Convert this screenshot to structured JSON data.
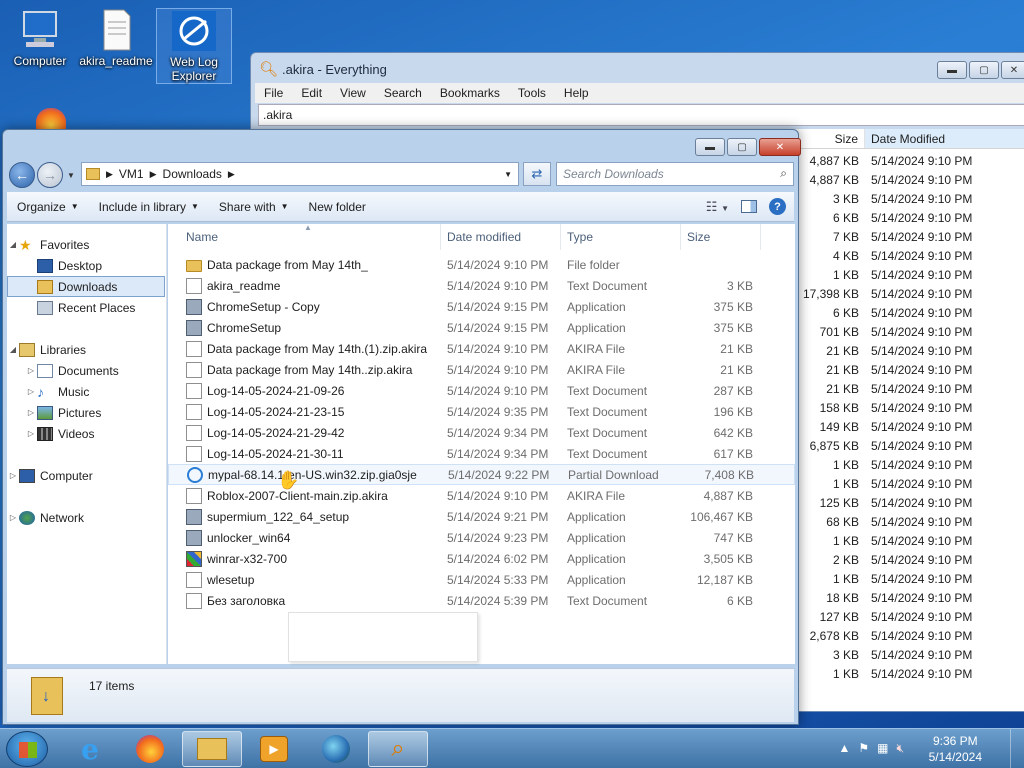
{
  "desktop": {
    "icons": [
      {
        "label": "Computer"
      },
      {
        "label": "akira_readme"
      },
      {
        "label": "Web Log Explorer"
      }
    ]
  },
  "everything": {
    "title": ".akira - Everything",
    "menu": [
      "File",
      "Edit",
      "View",
      "Search",
      "Bookmarks",
      "Tools",
      "Help"
    ],
    "search_value": ".akira",
    "col_size": "Size",
    "col_date": "Date Modified",
    "rows": [
      {
        "size": "4,887 KB",
        "date": "5/14/2024 9:10 PM"
      },
      {
        "size": "4,887 KB",
        "date": "5/14/2024 9:10 PM"
      },
      {
        "size": "3 KB",
        "date": "5/14/2024 9:10 PM"
      },
      {
        "size": "6 KB",
        "date": "5/14/2024 9:10 PM"
      },
      {
        "size": "7 KB",
        "date": "5/14/2024 9:10 PM"
      },
      {
        "size": "4 KB",
        "date": "5/14/2024 9:10 PM"
      },
      {
        "size": "1 KB",
        "date": "5/14/2024 9:10 PM"
      },
      {
        "size": "17,398 KB",
        "date": "5/14/2024 9:10 PM"
      },
      {
        "size": "6 KB",
        "date": "5/14/2024 9:10 PM"
      },
      {
        "size": "701 KB",
        "date": "5/14/2024 9:10 PM"
      },
      {
        "size": "21 KB",
        "date": "5/14/2024 9:10 PM"
      },
      {
        "size": "21 KB",
        "date": "5/14/2024 9:10 PM"
      },
      {
        "size": "21 KB",
        "date": "5/14/2024 9:10 PM"
      },
      {
        "size": "158 KB",
        "date": "5/14/2024 9:10 PM"
      },
      {
        "size": "149 KB",
        "date": "5/14/2024 9:10 PM"
      },
      {
        "size": "6,875 KB",
        "date": "5/14/2024 9:10 PM"
      },
      {
        "size": "1 KB",
        "date": "5/14/2024 9:10 PM"
      },
      {
        "size": "1 KB",
        "date": "5/14/2024 9:10 PM"
      },
      {
        "size": "125 KB",
        "date": "5/14/2024 9:10 PM"
      },
      {
        "size": "68 KB",
        "date": "5/14/2024 9:10 PM"
      },
      {
        "size": "1 KB",
        "date": "5/14/2024 9:10 PM"
      },
      {
        "size": "2 KB",
        "date": "5/14/2024 9:10 PM"
      },
      {
        "size": "1 KB",
        "date": "5/14/2024 9:10 PM"
      },
      {
        "size": "18 KB",
        "date": "5/14/2024 9:10 PM"
      },
      {
        "size": "127 KB",
        "date": "5/14/2024 9:10 PM"
      },
      {
        "size": "2,678 KB",
        "date": "5/14/2024 9:10 PM"
      },
      {
        "size": "3 KB",
        "date": "5/14/2024 9:10 PM"
      },
      {
        "size": "1 KB",
        "date": "5/14/2024 9:10 PM"
      }
    ]
  },
  "explorer": {
    "breadcrumb": [
      "VM1",
      "Downloads"
    ],
    "search_placeholder": "Search Downloads",
    "toolbar": {
      "organize": "Organize",
      "include": "Include in library",
      "share": "Share with",
      "new_folder": "New folder"
    },
    "nav": {
      "favorites": "Favorites",
      "desktop": "Desktop",
      "downloads": "Downloads",
      "recent": "Recent Places",
      "libraries": "Libraries",
      "documents": "Documents",
      "music": "Music",
      "pictures": "Pictures",
      "videos": "Videos",
      "computer": "Computer",
      "network": "Network"
    },
    "columns": {
      "name": "Name",
      "date": "Date modified",
      "type": "Type",
      "size": "Size"
    },
    "files": [
      {
        "name": "Data package from May 14th_",
        "date": "5/14/2024 9:10 PM",
        "type": "File folder",
        "size": "",
        "icon": "folder-icon"
      },
      {
        "name": "akira_readme",
        "date": "5/14/2024 9:10 PM",
        "type": "Text Document",
        "size": "3 KB",
        "icon": "text-file-icon"
      },
      {
        "name": "ChromeSetup - Copy",
        "date": "5/14/2024 9:15 PM",
        "type": "Application",
        "size": "375 KB",
        "icon": "application-icon"
      },
      {
        "name": "ChromeSetup",
        "date": "5/14/2024 9:15 PM",
        "type": "Application",
        "size": "375 KB",
        "icon": "application-icon"
      },
      {
        "name": "Data package from May 14th.(1).zip.akira",
        "date": "5/14/2024 9:10 PM",
        "type": "AKIRA File",
        "size": "21 KB",
        "icon": "blank-file-icon"
      },
      {
        "name": "Data package from May 14th..zip.akira",
        "date": "5/14/2024 9:10 PM",
        "type": "AKIRA File",
        "size": "21 KB",
        "icon": "blank-file-icon"
      },
      {
        "name": "Log-14-05-2024-21-09-26",
        "date": "5/14/2024 9:10 PM",
        "type": "Text Document",
        "size": "287 KB",
        "icon": "text-file-icon"
      },
      {
        "name": "Log-14-05-2024-21-23-15",
        "date": "5/14/2024 9:35 PM",
        "type": "Text Document",
        "size": "196 KB",
        "icon": "text-file-icon"
      },
      {
        "name": "Log-14-05-2024-21-29-42",
        "date": "5/14/2024 9:34 PM",
        "type": "Text Document",
        "size": "642 KB",
        "icon": "text-file-icon"
      },
      {
        "name": "Log-14-05-2024-21-30-11",
        "date": "5/14/2024 9:34 PM",
        "type": "Text Document",
        "size": "617 KB",
        "icon": "text-file-icon"
      },
      {
        "name": "mypal-68.14.1-en-US.win32.zip.gia0sje",
        "date": "5/14/2024 9:22 PM",
        "type": "Partial Download",
        "size": "7,408 KB",
        "icon": "ie-icon"
      },
      {
        "name": "Roblox-2007-Client-main.zip.akira",
        "date": "5/14/2024 9:10 PM",
        "type": "AKIRA File",
        "size": "4,887 KB",
        "icon": "blank-file-icon"
      },
      {
        "name": "supermium_122_64_setup",
        "date": "5/14/2024 9:21 PM",
        "type": "Application",
        "size": "106,467 KB",
        "icon": "installer-icon"
      },
      {
        "name": "unlocker_win64",
        "date": "5/14/2024 9:23 PM",
        "type": "Application",
        "size": "747 KB",
        "icon": "application-icon"
      },
      {
        "name": "winrar-x32-700",
        "date": "5/14/2024 6:02 PM",
        "type": "Application",
        "size": "3,505 KB",
        "icon": "winrar-icon"
      },
      {
        "name": "wlesetup",
        "date": "5/14/2024 5:33 PM",
        "type": "Application",
        "size": "12,187 KB",
        "icon": "blank-file-icon"
      },
      {
        "name": "Без заголовка",
        "date": "5/14/2024 5:39 PM",
        "type": "Text Document",
        "size": "6 KB",
        "icon": "text-file-icon"
      }
    ],
    "status": "17 items"
  },
  "taskbar": {
    "time": "9:36 PM",
    "date": "5/14/2024"
  }
}
